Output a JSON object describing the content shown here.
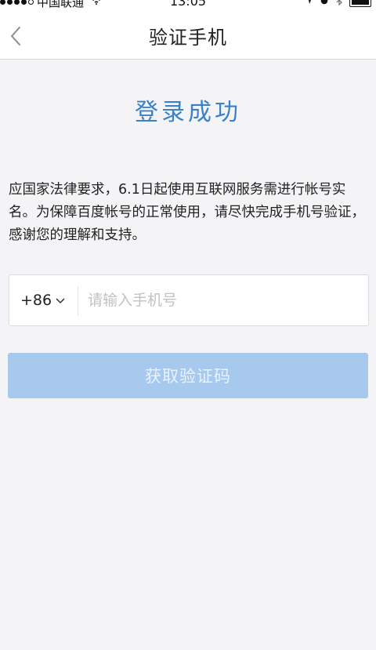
{
  "status_bar": {
    "carrier": "中国联通",
    "wifi_icon": "wifi-icon",
    "time": "13:05",
    "right_icons": [
      "location-arrow-icon",
      "alarm-icon",
      "bluetooth-icon",
      "battery-icon"
    ]
  },
  "nav": {
    "back_icon": "chevron-left-icon",
    "title": "验证手机"
  },
  "main": {
    "success_title": "登录成功",
    "notice_text": "应国家法律要求，6.1日起使用互联网服务需进行帐号实名。为保障百度帐号的正常使用，请尽快完成手机号验证，感谢您的理解和支持。",
    "country_code": "+86",
    "phone_placeholder": "请输入手机号",
    "phone_value": "",
    "get_code_label": "获取验证码"
  },
  "colors": {
    "accent": "#3a82c7",
    "button_disabled": "#a8c9ee",
    "background": "#f4f4f6"
  }
}
